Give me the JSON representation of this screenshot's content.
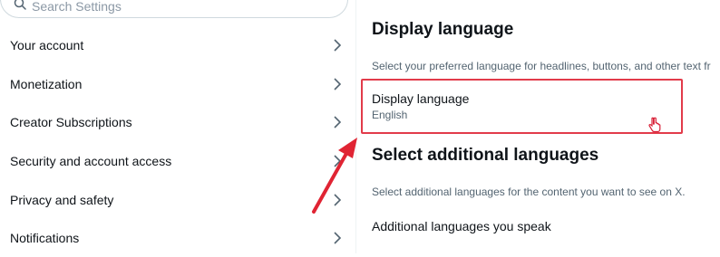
{
  "search": {
    "placeholder": "Search Settings",
    "icon": "search-icon"
  },
  "sidebar": {
    "items": [
      {
        "label": "Your account"
      },
      {
        "label": "Monetization"
      },
      {
        "label": "Creator Subscriptions"
      },
      {
        "label": "Security and account access"
      },
      {
        "label": "Privacy and safety"
      },
      {
        "label": "Notifications"
      }
    ],
    "chevron_icon": "chevron-right-icon"
  },
  "main": {
    "title": "Display language",
    "description": "Select your preferred language for headlines, buttons, and other text fr",
    "display_language": {
      "label": "Display language",
      "value": "English"
    },
    "additional_title": "Select additional languages",
    "additional_description": "Select additional languages for the content you want to see on X.",
    "additional_row_label": "Additional languages you speak"
  },
  "colors": {
    "highlight_border": "#e23b4a",
    "annotation_arrow": "#e02433",
    "muted_text": "#536471",
    "primary_text": "#0f1419"
  }
}
